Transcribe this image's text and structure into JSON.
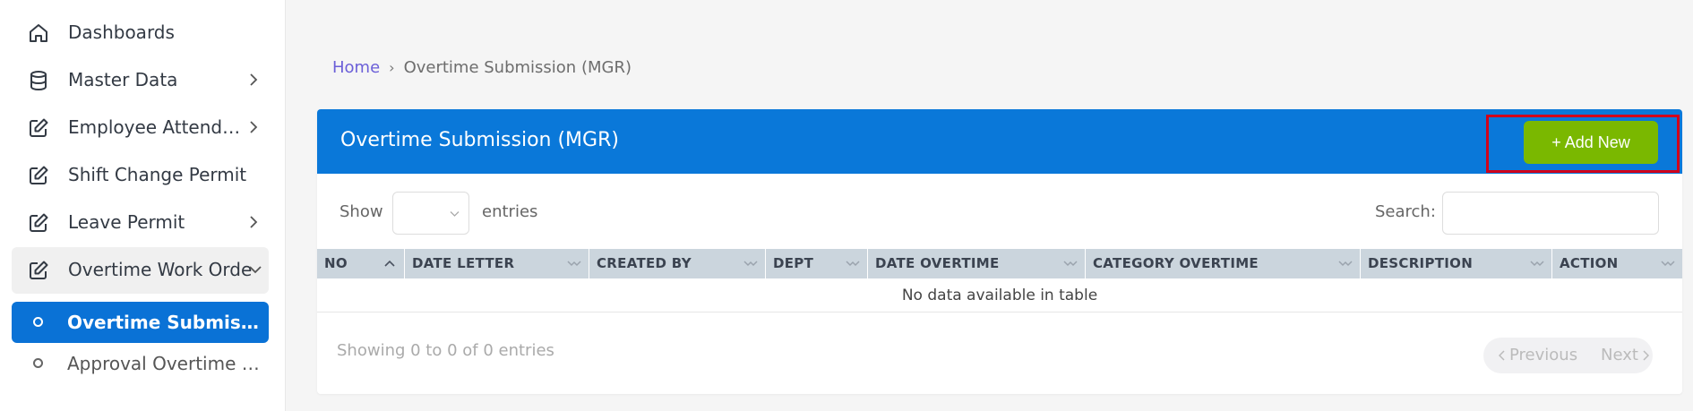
{
  "sidebar": {
    "items": [
      {
        "label": "Dashboards",
        "icon": "home-icon",
        "has_chevron": false
      },
      {
        "label": "Master Data",
        "icon": "database-icon",
        "has_chevron": true
      },
      {
        "label": "Employee Attendance",
        "icon": "edit-icon",
        "has_chevron": true
      },
      {
        "label": "Shift Change Permit",
        "icon": "edit-icon",
        "has_chevron": false
      },
      {
        "label": "Leave Permit",
        "icon": "edit-icon",
        "has_chevron": true
      },
      {
        "label": "Overtime Work Order",
        "icon": "edit-icon",
        "has_chevron": true,
        "expanded": true
      }
    ],
    "sub_items": [
      {
        "label": "Overtime Submission (MGR)",
        "active": true
      },
      {
        "label": "Approval Overtime (MGR)",
        "active": false
      }
    ]
  },
  "breadcrumb": {
    "home": "Home",
    "separator": "›",
    "current": "Overtime Submission (MGR)"
  },
  "card": {
    "title": "Overtime Submission (MGR)",
    "add_button": "+ Add New"
  },
  "controls": {
    "show_label": "Show",
    "show_value": "",
    "entries_label": "entries",
    "search_label": "Search:",
    "search_value": ""
  },
  "table": {
    "columns": [
      "NO",
      "DATE LETTER",
      "CREATED BY",
      "DEPT",
      "DATE OVERTIME",
      "CATEGORY OVERTIME",
      "DESCRIPTION",
      "ACTION"
    ],
    "empty_text": "No data available in table"
  },
  "footer": {
    "info": "Showing 0 to 0 of 0 entries",
    "previous": "Previous",
    "next": "Next"
  },
  "colors": {
    "header_blue": "#0a78d9",
    "active_nav": "#0a72d6",
    "add_button_green": "#7ab800",
    "highlight_red": "#d0021b",
    "breadcrumb_link": "#6b5fd8",
    "table_header": "#cbd5dd"
  }
}
